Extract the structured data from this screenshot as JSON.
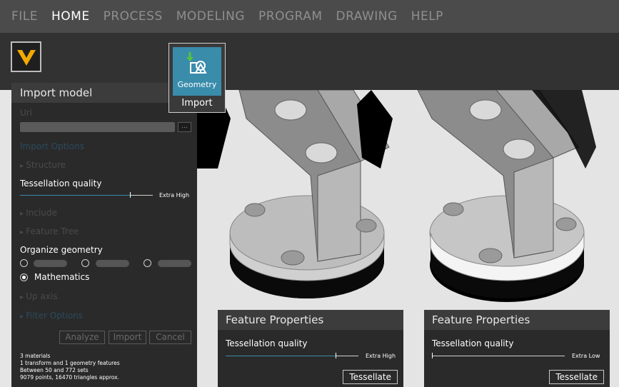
{
  "menu": {
    "items": [
      {
        "label": "FILE"
      },
      {
        "label": "HOME",
        "active": true
      },
      {
        "label": "PROCESS"
      },
      {
        "label": "MODELING"
      },
      {
        "label": "PROGRAM"
      },
      {
        "label": "DRAWING"
      },
      {
        "label": "HELP"
      }
    ]
  },
  "ribbon": {
    "logo_icon": "v-logo-icon",
    "import_group": {
      "button_label": "Geometry",
      "button_icon": "geometry-import-icon",
      "group_label": "Import"
    }
  },
  "import_panel": {
    "title": "Import model",
    "uri_label": "Uri",
    "uri_value": "",
    "browse_label": "...",
    "import_options_label": "Import Options",
    "structure_label": "Structure",
    "tessellation_label": "Tessellation quality",
    "tessellation_value": "Extra High",
    "tessellation_level": 0.83,
    "include_label": "Include",
    "feature_tree_label": "Feature Tree",
    "organize_label": "Organize geometry",
    "organize_selected": "Mathematics",
    "up_axis_label": "Up axis",
    "filter_options_label": "Filter Options",
    "buttons": {
      "analyze": "Analyze",
      "import": "Import",
      "cancel": "Cancel"
    },
    "stats": [
      "3 materials",
      "1 transform and 1 geometry features",
      "Between 50 and 772 sets",
      "9079 points, 16470 triangles approx."
    ]
  },
  "feature_panels": [
    {
      "title": "Feature Properties",
      "tessellation_label": "Tessellation quality",
      "tessellation_value": "Extra High",
      "tessellation_level": 0.83,
      "button_label": "Tessellate"
    },
    {
      "title": "Feature Properties",
      "tessellation_label": "Tessellation quality",
      "tessellation_value": "Extra Low",
      "tessellation_level": 0.0,
      "button_label": "Tessellate"
    }
  ],
  "colors": {
    "accent": "#3a8cab",
    "menubar": "#4b4b4b",
    "ribbon": "#323232",
    "panel": "#2a2a2a",
    "viewport": "#e4e4e4"
  }
}
